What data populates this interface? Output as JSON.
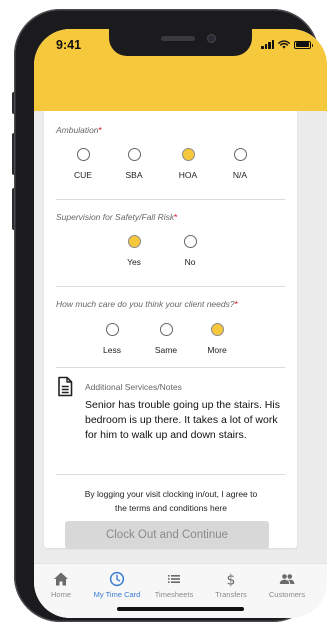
{
  "status_bar": {
    "time": "9:41"
  },
  "ambulation": {
    "label": "Ambulation",
    "required_mark": "*",
    "options": [
      {
        "label": "CUE",
        "selected": false
      },
      {
        "label": "SBA",
        "selected": false
      },
      {
        "label": "HOA",
        "selected": true
      },
      {
        "label": "N/A",
        "selected": false
      }
    ]
  },
  "supervision": {
    "label": "Supervision for Safety/Fall Risk",
    "required_mark": "*",
    "options": [
      {
        "label": "Yes",
        "selected": true
      },
      {
        "label": "No",
        "selected": false
      }
    ]
  },
  "care_needs": {
    "label": "How much care do you think your client needs?",
    "required_mark": "*",
    "options": [
      {
        "label": "Less",
        "selected": false
      },
      {
        "label": "Same",
        "selected": false
      },
      {
        "label": "More",
        "selected": true
      }
    ]
  },
  "notes": {
    "icon": "document-icon",
    "title": "Additional Services/Notes",
    "text": "Senior has trouble going up the stairs. His bedroom is up there. It takes a lot of work for him to walk up and down stairs."
  },
  "terms": {
    "line1": "By logging your visit clocking in/out, I agree to",
    "line2": "the terms and conditions here"
  },
  "clock_out_button": "Clock Out and Continue",
  "tabs": [
    {
      "label": "Home",
      "icon": "home-icon",
      "active": false
    },
    {
      "label": "My Time Card",
      "icon": "clock-icon",
      "active": true
    },
    {
      "label": "Timesheets",
      "icon": "list-icon",
      "active": false
    },
    {
      "label": "Transfers",
      "icon": "dollar-icon",
      "active": false
    },
    {
      "label": "Customers",
      "icon": "people-icon",
      "active": false
    }
  ],
  "colors": {
    "accent": "#f6c83c",
    "active_tab": "#3a7bd5",
    "required": "#d0021b"
  }
}
